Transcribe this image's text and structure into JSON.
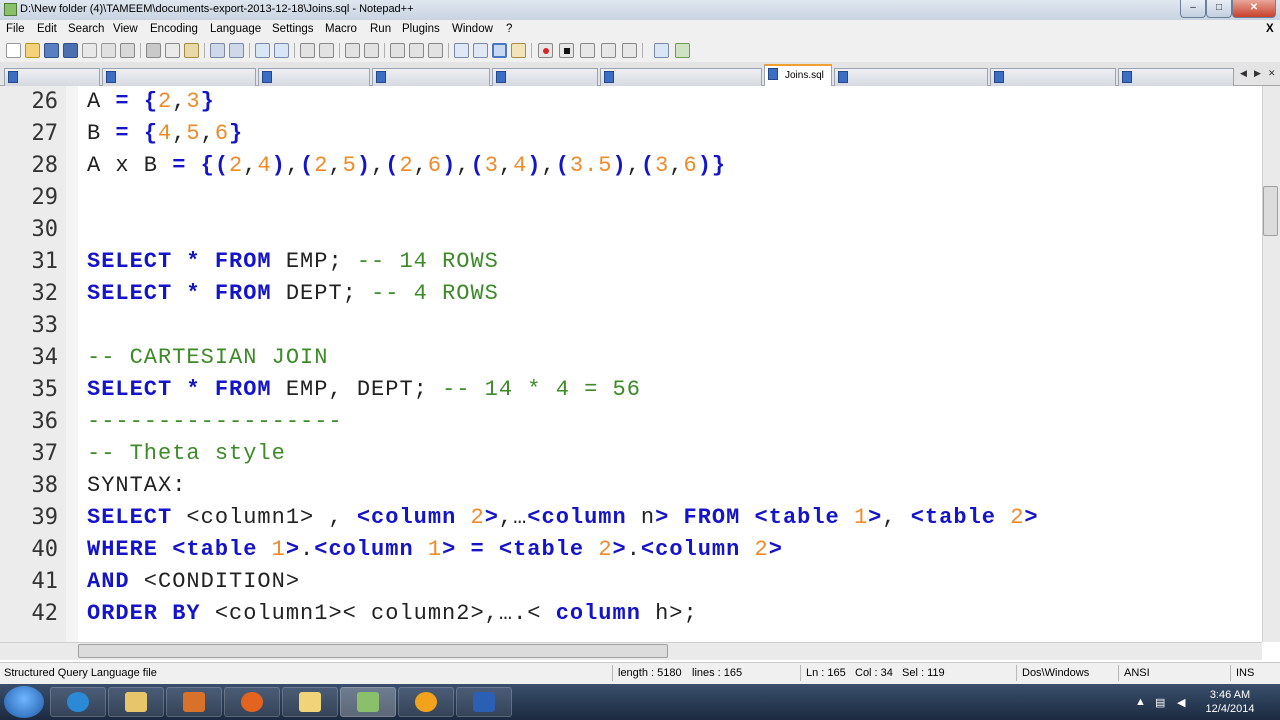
{
  "window": {
    "title": "D:\\New folder (4)\\TAMEEM\\documents-export-2013-12-18\\Joins.sql - Notepad++",
    "minimize": "–",
    "maximize": "□",
    "close": "✕"
  },
  "menu": {
    "items": [
      "File",
      "Edit",
      "Search",
      "View",
      "Encoding",
      "Language",
      "Settings",
      "Macro",
      "Run",
      "Plugins",
      "Window",
      "?"
    ],
    "close_doc": "X"
  },
  "tabs": {
    "active_label": "Joins.sql"
  },
  "editor": {
    "lines": [
      {
        "n": "26",
        "segments": [
          [
            "t",
            "A "
          ],
          [
            "op",
            "="
          ],
          [
            "t",
            " "
          ],
          [
            "op",
            "{"
          ],
          [
            "num",
            "2"
          ],
          [
            "t",
            ","
          ],
          [
            "num",
            "3"
          ],
          [
            "op",
            "}"
          ]
        ]
      },
      {
        "n": "27",
        "segments": [
          [
            "t",
            "B "
          ],
          [
            "op",
            "="
          ],
          [
            "t",
            " "
          ],
          [
            "op",
            "{"
          ],
          [
            "num",
            "4"
          ],
          [
            "t",
            ","
          ],
          [
            "num",
            "5"
          ],
          [
            "t",
            ","
          ],
          [
            "num",
            "6"
          ],
          [
            "op",
            "}"
          ]
        ]
      },
      {
        "n": "28",
        "segments": [
          [
            "t",
            "A x B "
          ],
          [
            "op",
            "="
          ],
          [
            "t",
            " "
          ],
          [
            "op",
            "{("
          ],
          [
            "num",
            "2"
          ],
          [
            "t",
            ","
          ],
          [
            "num",
            "4"
          ],
          [
            "op",
            ")"
          ],
          [
            "t",
            ","
          ],
          [
            "op",
            "("
          ],
          [
            "num",
            "2"
          ],
          [
            "t",
            ","
          ],
          [
            "num",
            "5"
          ],
          [
            "op",
            ")"
          ],
          [
            "t",
            ","
          ],
          [
            "op",
            "("
          ],
          [
            "num",
            "2"
          ],
          [
            "t",
            ","
          ],
          [
            "num",
            "6"
          ],
          [
            "op",
            ")"
          ],
          [
            "t",
            ","
          ],
          [
            "op",
            "("
          ],
          [
            "num",
            "3"
          ],
          [
            "t",
            ","
          ],
          [
            "num",
            "4"
          ],
          [
            "op",
            ")"
          ],
          [
            "t",
            ","
          ],
          [
            "op",
            "("
          ],
          [
            "num",
            "3.5"
          ],
          [
            "op",
            ")"
          ],
          [
            "t",
            ","
          ],
          [
            "op",
            "("
          ],
          [
            "num",
            "3"
          ],
          [
            "t",
            ","
          ],
          [
            "num",
            "6"
          ],
          [
            "op",
            ")}"
          ]
        ]
      },
      {
        "n": "29",
        "segments": []
      },
      {
        "n": "30",
        "segments": []
      },
      {
        "n": "31",
        "segments": [
          [
            "kw",
            "SELECT"
          ],
          [
            "t",
            " "
          ],
          [
            "op",
            "*"
          ],
          [
            "t",
            " "
          ],
          [
            "kw",
            "FROM"
          ],
          [
            "t",
            " EMP; "
          ],
          [
            "cm",
            "-- 14 ROWS"
          ]
        ]
      },
      {
        "n": "32",
        "segments": [
          [
            "kw",
            "SELECT"
          ],
          [
            "t",
            " "
          ],
          [
            "op",
            "*"
          ],
          [
            "t",
            " "
          ],
          [
            "kw",
            "FROM"
          ],
          [
            "t",
            " DEPT; "
          ],
          [
            "cm",
            "-- 4 ROWS"
          ]
        ]
      },
      {
        "n": "33",
        "segments": []
      },
      {
        "n": "34",
        "segments": [
          [
            "cm",
            "-- CARTESIAN JOIN"
          ]
        ]
      },
      {
        "n": "35",
        "segments": [
          [
            "kw",
            "SELECT"
          ],
          [
            "t",
            " "
          ],
          [
            "op",
            "*"
          ],
          [
            "t",
            " "
          ],
          [
            "kw",
            "FROM"
          ],
          [
            "t",
            " EMP, DEPT; "
          ],
          [
            "cm",
            "-- 14 * 4 = 56"
          ]
        ]
      },
      {
        "n": "36",
        "segments": [
          [
            "cm",
            "------------------"
          ]
        ]
      },
      {
        "n": "37",
        "segments": [
          [
            "cm",
            "-- Theta style"
          ]
        ]
      },
      {
        "n": "38",
        "segments": [
          [
            "t",
            "SYNTAX:"
          ]
        ]
      },
      {
        "n": "39",
        "segments": [
          [
            "kw",
            "SELECT"
          ],
          [
            "t",
            " <column1> , "
          ],
          [
            "kw",
            "<column "
          ],
          [
            "num",
            "2"
          ],
          [
            "kw",
            ">"
          ],
          [
            "t",
            ",…"
          ],
          [
            "kw",
            "<column"
          ],
          [
            "t",
            " n"
          ],
          [
            "kw",
            ">"
          ],
          [
            "t",
            " "
          ],
          [
            "kw",
            "FROM"
          ],
          [
            "t",
            " "
          ],
          [
            "kw",
            "<table "
          ],
          [
            "num",
            "1"
          ],
          [
            "kw",
            ">"
          ],
          [
            "t",
            ", "
          ],
          [
            "kw",
            "<table "
          ],
          [
            "num",
            "2"
          ],
          [
            "kw",
            ">"
          ]
        ]
      },
      {
        "n": "40",
        "segments": [
          [
            "kw",
            "WHERE"
          ],
          [
            "t",
            " "
          ],
          [
            "kw",
            "<table "
          ],
          [
            "num",
            "1"
          ],
          [
            "kw",
            ">"
          ],
          [
            "t",
            "."
          ],
          [
            "kw",
            "<column "
          ],
          [
            "num",
            "1"
          ],
          [
            "kw",
            ">"
          ],
          [
            "t",
            " "
          ],
          [
            "op",
            "="
          ],
          [
            "t",
            " "
          ],
          [
            "kw",
            "<table "
          ],
          [
            "num",
            "2"
          ],
          [
            "kw",
            ">"
          ],
          [
            "t",
            "."
          ],
          [
            "kw",
            "<column "
          ],
          [
            "num",
            "2"
          ],
          [
            "kw",
            ">"
          ]
        ]
      },
      {
        "n": "41",
        "segments": [
          [
            "kw",
            "AND"
          ],
          [
            "t",
            " <CONDITION>"
          ]
        ]
      },
      {
        "n": "42",
        "segments": [
          [
            "kw",
            "ORDER BY"
          ],
          [
            "t",
            " <column1>< column2>,….< "
          ],
          [
            "kw",
            "column"
          ],
          [
            "t",
            " h>;"
          ]
        ]
      }
    ]
  },
  "statusbar": {
    "filetype": "Structured Query Language file",
    "length": "length : 5180",
    "lines": "lines : 165",
    "ln": "Ln : 165",
    "col": "Col : 34",
    "sel": "Sel : 119",
    "eol": "Dos\\Windows",
    "encoding": "ANSI",
    "mode": "INS"
  },
  "taskbar": {
    "time": "3:46 AM",
    "date": "12/4/2014"
  },
  "colors": {
    "keyword": "#1414c8",
    "number": "#f08a28",
    "comment": "#3c8a28",
    "text": "#222222"
  }
}
